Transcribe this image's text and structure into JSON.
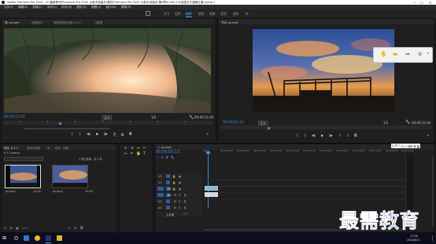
{
  "titlebar": {
    "title": "Adobe Premiere Pro 2020 - D:\\最新教材\\Premiere Pro 2020 从新手到高手\\素材\\Premiere Pro 2020 从新手到高手\\第6章\\6.3\\6.3.3\\创建交叉溶解过渡.prproj *",
    "min": "—",
    "max": "☐",
    "close": "✕"
  },
  "menu": [
    "文件(F)",
    "编辑(E)",
    "剪辑(C)",
    "序列(S)",
    "标记(M)",
    "图形(G)",
    "视图(V)",
    "窗口(W)",
    "帮助(H)"
  ],
  "workspace": {
    "tabs": [
      "学习",
      "组件",
      "编辑",
      "颜色",
      "效果",
      "音频",
      "图形",
      "库"
    ],
    "active": "编辑"
  },
  "source": {
    "tabs": [
      "源: ps.mp4",
      "效果控件",
      "音频剪辑混合器: 6.3.3",
      "元数据"
    ],
    "timecode_in": "00;00;13;05",
    "fit": "适合",
    "zoom": "1/2",
    "timecode_dur": "00;00;11;04"
  },
  "program": {
    "tab": "节目: ps.mp4",
    "timecode_in": "00;00;02;15",
    "fit": "适合",
    "zoom": "1/2",
    "timecode_dur": "00;00;12;04"
  },
  "project": {
    "tabs": [
      "项目: 6.3.3",
      "媒体浏览器",
      "库",
      "信息",
      "效果"
    ],
    "search_placeholder": "",
    "file_name": "6.3.3.prproj",
    "count_label": "1 项已选择，共 2 项",
    "items": [
      {
        "name": "ps.mp4",
        "duration": "13;02"
      },
      {
        "name": "ps.mp4",
        "duration": "12;04"
      }
    ]
  },
  "timeline": {
    "tab": "ps.mp4",
    "timecode": "00;00;03;13",
    "ruler_labels": [
      "00;00",
      "00;00;02;00",
      "00;00;04;00",
      "00;00;06;00",
      "00;00;08;00",
      "00;00;10;00",
      "00;00;12;00",
      "00;00;14;00",
      "00;00;16;00",
      "00;00;18;00",
      "00;00;20;00",
      "00;00;22;00",
      "00;00;24;00"
    ],
    "tracks": [
      {
        "name": "V3",
        "label": "V3"
      },
      {
        "name": "V2",
        "label": "V2"
      },
      {
        "name": "V1",
        "label": "V1"
      },
      {
        "name": "A1",
        "label": "A1"
      },
      {
        "name": "A2",
        "label": "A2"
      },
      {
        "name": "A3",
        "label": "A3"
      },
      {
        "name": "主声道",
        "label": "主声道",
        "value": "0.0"
      }
    ]
  },
  "taskbar": {
    "time": "17:56",
    "date": "2021/6/22"
  },
  "watermark": "最需教育",
  "colors": {
    "accent": "#3b8cf1",
    "timecode": "#3b8cf1",
    "watermark": "#1a36c8"
  }
}
